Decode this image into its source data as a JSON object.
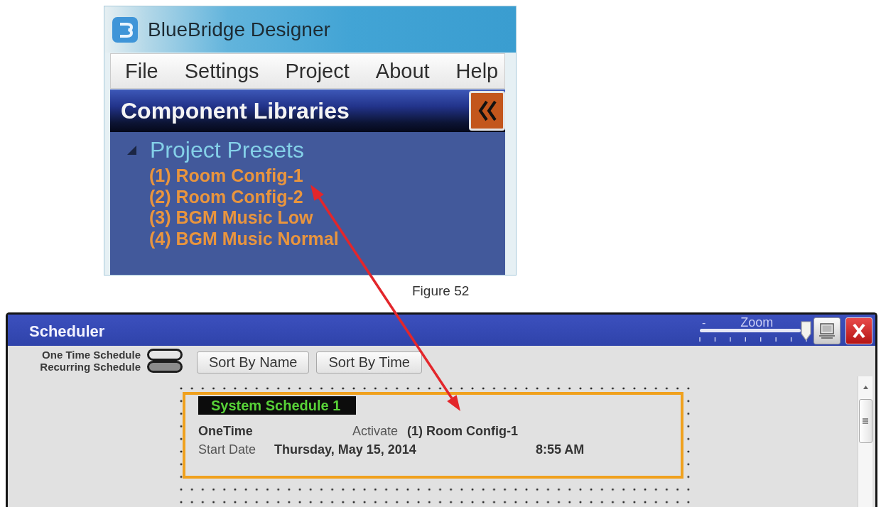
{
  "designer": {
    "title": "BlueBridge Designer",
    "menu": [
      "File",
      "Settings",
      "Project",
      "About",
      "Help"
    ],
    "panel": {
      "title": "Component Libraries",
      "tree": [
        {
          "label": "Project Presets",
          "expanded": true,
          "children": [
            {
              "label": "(1) Room Config-1"
            },
            {
              "label": "(2) Room Config-2"
            },
            {
              "label": "(3) BGM Music Low"
            },
            {
              "label": "(4) BGM Music Normal"
            }
          ]
        }
      ]
    }
  },
  "caption": "Figure 52",
  "scheduler": {
    "title": "Scheduler",
    "zoom": {
      "min_label": "-",
      "label": "Zoom",
      "level": 1
    },
    "legend": [
      {
        "label": "One Time Schedule",
        "color": "#e6e6e6"
      },
      {
        "label": "Recurring Schedule",
        "color": "#8c8c8c"
      }
    ],
    "buttons": [
      "Sort By Name",
      "Sort By Time"
    ],
    "schedules": [
      {
        "name": "System Schedule 1",
        "selected": true,
        "type": "OneTime",
        "activate_label": "Activate",
        "preset": "(1) Room Config-1",
        "start_label": "Start Date",
        "start_date": "Thursday, May 15, 2014",
        "time": "8:55 AM"
      }
    ]
  }
}
